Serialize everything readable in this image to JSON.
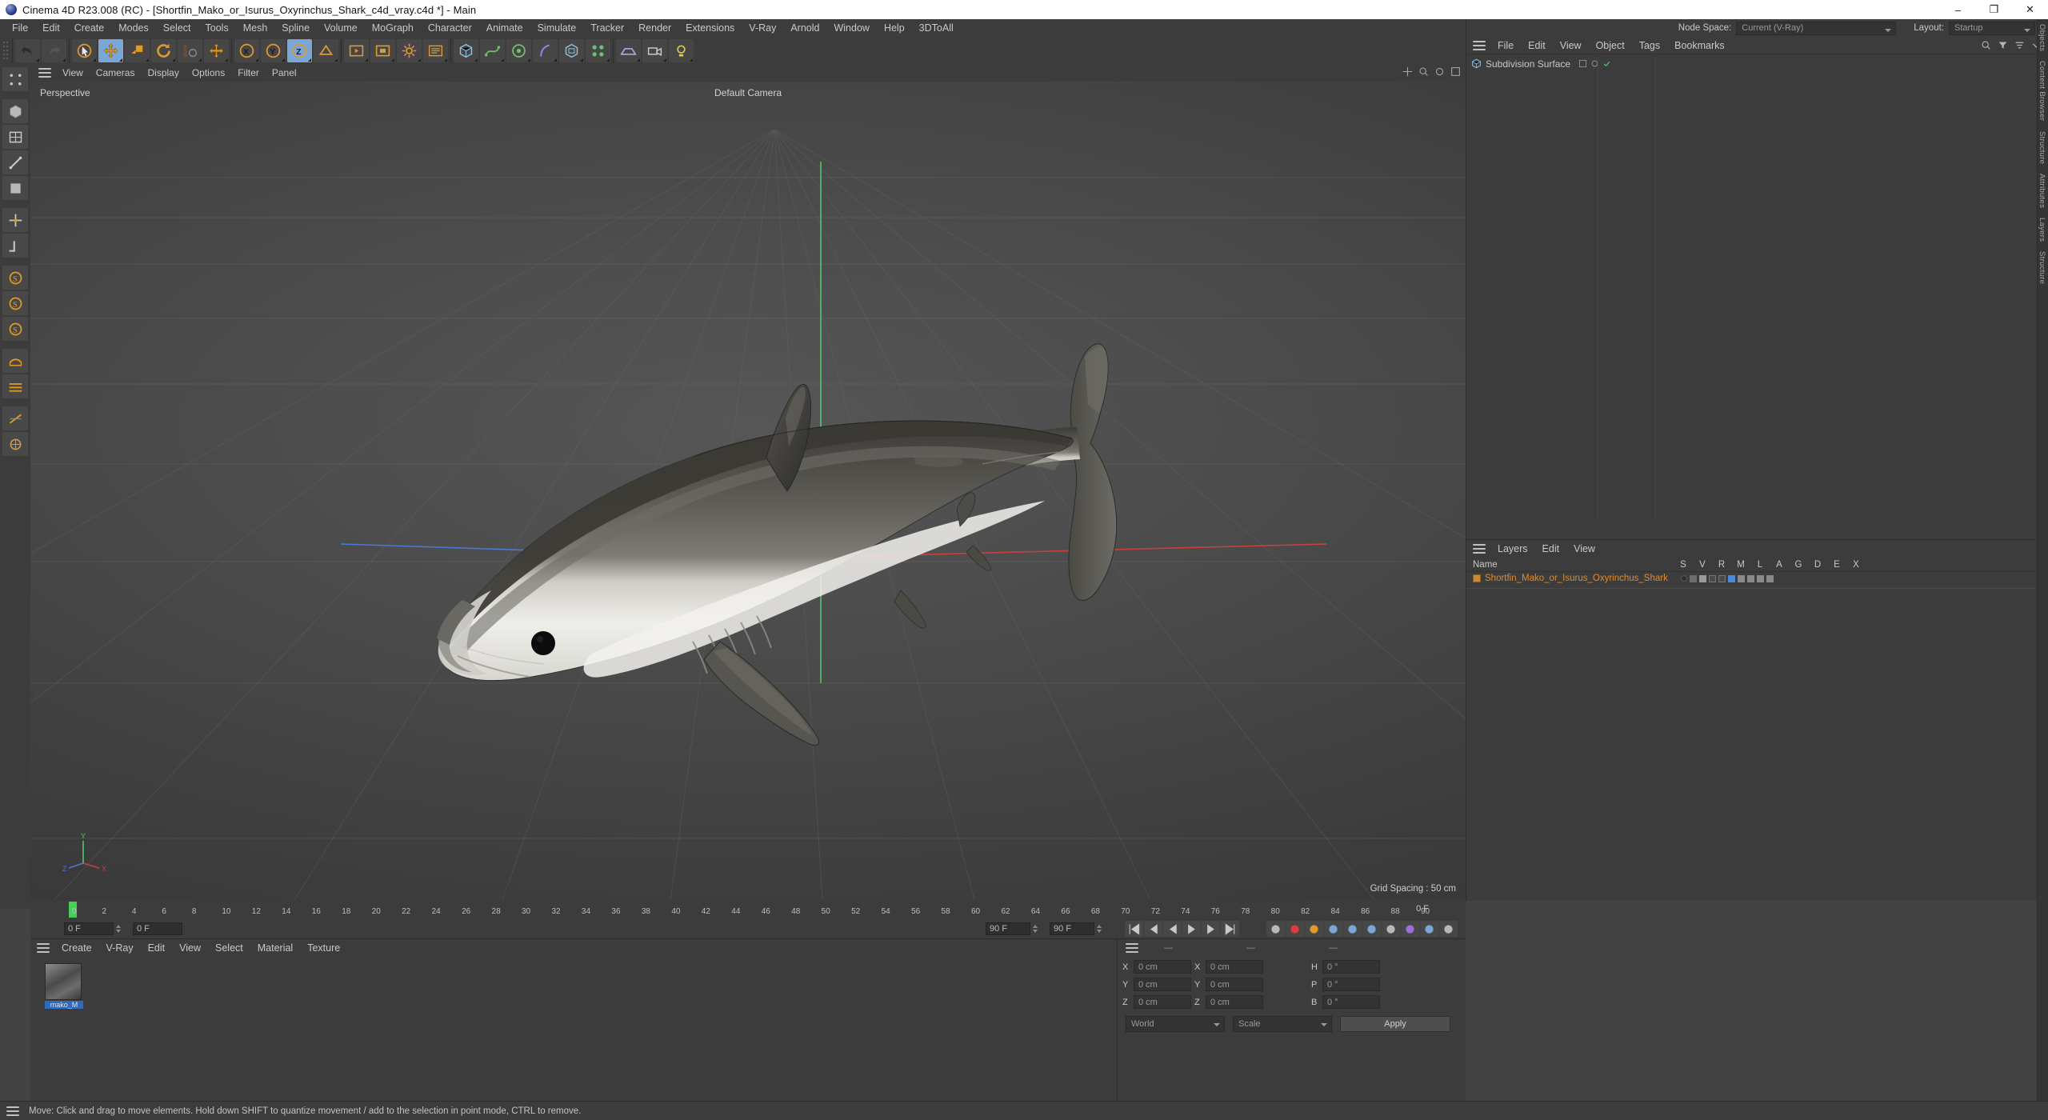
{
  "window": {
    "title": "Cinema 4D R23.008 (RC) - [Shortfin_Mako_or_Isurus_Oxyrinchus_Shark_c4d_vray.c4d *] - Main",
    "minimize": "–",
    "maximize": "❐",
    "close": "✕"
  },
  "menubar": {
    "items": [
      "File",
      "Edit",
      "Create",
      "Modes",
      "Select",
      "Tools",
      "Mesh",
      "Spline",
      "Volume",
      "MoGraph",
      "Character",
      "Animate",
      "Simulate",
      "Tracker",
      "Render",
      "Extensions",
      "V-Ray",
      "Arnold",
      "Window",
      "Help",
      "3DToAll"
    ]
  },
  "toolbar": {
    "groups": [
      {
        "name": "history",
        "buttons": [
          {
            "id": "undo",
            "icon": "undo-arrow-icon",
            "state": "dark"
          },
          {
            "id": "redo",
            "icon": "redo-arrow-icon",
            "state": "dark"
          }
        ]
      },
      {
        "name": "transform",
        "buttons": [
          {
            "id": "select",
            "icon": "live-selection-icon",
            "state": "dark"
          },
          {
            "id": "move",
            "icon": "move-tool-icon",
            "state": "selected"
          },
          {
            "id": "scale",
            "icon": "scale-tool-icon",
            "state": "dark"
          },
          {
            "id": "rotate",
            "icon": "rotate-tool-icon",
            "state": "dark"
          },
          {
            "id": "psr",
            "icon": "psr-icon",
            "state": "dark"
          },
          {
            "id": "move-axis",
            "icon": "move-axis-icon",
            "state": "dark"
          }
        ]
      },
      {
        "name": "axis-locks",
        "buttons": [
          {
            "id": "lock-x",
            "icon": "x-axis-lock-icon",
            "state": "dark"
          },
          {
            "id": "lock-y",
            "icon": "y-axis-lock-icon",
            "state": "dark"
          },
          {
            "id": "lock-z",
            "icon": "z-axis-lock-icon",
            "state": "selected"
          },
          {
            "id": "world-object",
            "icon": "world-coordinate-icon",
            "state": "dark"
          }
        ]
      },
      {
        "name": "render",
        "buttons": [
          {
            "id": "render-view",
            "icon": "render-view-icon",
            "state": "dark"
          },
          {
            "id": "render-region",
            "icon": "render-region-icon",
            "state": "dark"
          },
          {
            "id": "render-settings",
            "icon": "render-settings-icon",
            "state": "dark"
          },
          {
            "id": "render-queue",
            "icon": "render-queue-icon",
            "state": "dark"
          }
        ]
      },
      {
        "name": "primitives",
        "buttons": [
          {
            "id": "cube",
            "icon": "cube-primitive-icon",
            "state": "dark"
          },
          {
            "id": "spline-pen",
            "icon": "spline-pen-icon",
            "state": "dark"
          },
          {
            "id": "array",
            "icon": "array-generator-icon",
            "state": "dark"
          },
          {
            "id": "bend",
            "icon": "bend-deformer-icon",
            "state": "dark"
          },
          {
            "id": "subdivision",
            "icon": "subdivision-surface-icon",
            "state": "dark"
          },
          {
            "id": "mograph",
            "icon": "mograph-cloner-icon",
            "state": "dark"
          }
        ]
      },
      {
        "name": "scene",
        "buttons": [
          {
            "id": "floor",
            "icon": "floor-object-icon",
            "state": "dark"
          },
          {
            "id": "camera",
            "icon": "camera-object-icon",
            "state": "dark"
          },
          {
            "id": "light",
            "icon": "light-object-icon",
            "state": "dark"
          }
        ]
      }
    ]
  },
  "left_palette": {
    "buttons": [
      {
        "id": "point-mode",
        "icon": "point-mode-icon"
      },
      {
        "id": "model-mode",
        "icon": "model-mode-icon"
      },
      {
        "id": "texture-mode",
        "icon": "texture-mode-icon"
      },
      {
        "id": "edge-mode",
        "icon": "edge-mode-icon"
      },
      {
        "id": "polygon-mode",
        "icon": "polygon-mode-icon"
      },
      {
        "id": "enable-axis",
        "icon": "enable-axis-icon"
      },
      {
        "id": "workplane",
        "icon": "workplane-icon"
      },
      {
        "id": "snap-settings",
        "icon": "snap-magnet-icon"
      },
      {
        "id": "snap-quantize",
        "icon": "quantize-snap-icon"
      },
      {
        "id": "snap-workplane",
        "icon": "workplane-snap-icon"
      },
      {
        "id": "viewport-solo",
        "icon": "viewport-solo-icon"
      },
      {
        "id": "layout-grid",
        "icon": "layout-grid-icon"
      },
      {
        "id": "deformer-cage",
        "icon": "deformer-cage-icon"
      },
      {
        "id": "uv-mesh",
        "icon": "uv-mesh-icon"
      }
    ]
  },
  "viewport": {
    "menu": [
      "View",
      "Cameras",
      "Display",
      "Options",
      "Filter",
      "Panel"
    ],
    "label_perspective": "Perspective",
    "label_camera": "Default Camera",
    "grid_spacing": "Grid Spacing : 50 cm",
    "axis_labels": {
      "x": "X",
      "y": "Y",
      "z": "Z"
    },
    "gizmo_colors": {
      "x": "#d24a4a",
      "y": "#4fc96a",
      "z": "#4a78d2"
    }
  },
  "object_manager": {
    "menu": [
      "File",
      "Edit",
      "View",
      "Object",
      "Tags",
      "Bookmarks"
    ],
    "node_space_label": "Node Space:",
    "node_space_value": "Current (V-Ray)",
    "layout_label": "Layout:",
    "layout_value": "Startup",
    "items": [
      {
        "name": "Subdivision Surface",
        "icon": "subdivision-surface-icon",
        "color": "#d8d8d8"
      }
    ]
  },
  "layer_manager": {
    "menu": [
      "Layers",
      "Edit",
      "View"
    ],
    "column_name": "Name",
    "flag_columns": [
      "S",
      "V",
      "R",
      "M",
      "L",
      "A",
      "G",
      "D",
      "E",
      "X"
    ],
    "rows": [
      {
        "name": "Shortfin_Mako_or_Isurus_Oxyrinchus_Shark",
        "color": "#e08b2c"
      }
    ]
  },
  "right_tabs": [
    "Objects",
    "Content Browser",
    "Structure",
    "Attributes",
    "Layers",
    "Structure"
  ],
  "timeline": {
    "ticks": [
      "0",
      "2",
      "4",
      "6",
      "8",
      "10",
      "12",
      "14",
      "16",
      "18",
      "20",
      "22",
      "24",
      "26",
      "28",
      "30",
      "32",
      "34",
      "36",
      "38",
      "40",
      "42",
      "44",
      "46",
      "48",
      "50",
      "52",
      "54",
      "56",
      "58",
      "60",
      "62",
      "64",
      "66",
      "68",
      "70",
      "72",
      "74",
      "76",
      "78",
      "80",
      "82",
      "84",
      "86",
      "88",
      "90"
    ],
    "current_frame": "0 F",
    "end_marker": "0 F"
  },
  "timeline_bar": {
    "frame_start": "0 F",
    "frame_current": "0 F",
    "frame_end": "90 F",
    "frame_preview_end": "90 F",
    "transport": [
      {
        "id": "goto-start",
        "icon": "skip-start-icon"
      },
      {
        "id": "step-back",
        "icon": "step-back-icon"
      },
      {
        "id": "play-back",
        "icon": "play-reverse-icon"
      },
      {
        "id": "play",
        "icon": "play-icon"
      },
      {
        "id": "step-forward",
        "icon": "step-forward-icon"
      },
      {
        "id": "goto-end",
        "icon": "skip-end-icon"
      }
    ],
    "record_tools": [
      {
        "id": "record-active",
        "icon": "record-active-objects-icon",
        "color": "#b8b8b8"
      },
      {
        "id": "autokey",
        "icon": "autokey-icon",
        "color": "#e03a3a"
      },
      {
        "id": "keyframe-select",
        "icon": "keyframe-selection-icon",
        "color": "#e09a2c"
      },
      {
        "id": "position-key",
        "icon": "position-key-icon",
        "color": "#7aa7d8"
      },
      {
        "id": "rotation-key",
        "icon": "rotation-key-icon",
        "color": "#7aa7d8"
      },
      {
        "id": "scale-key",
        "icon": "scale-key-icon",
        "color": "#7aa7d8"
      },
      {
        "id": "param-key",
        "icon": "parameter-key-icon",
        "color": "#b8b8b8"
      },
      {
        "id": "pla-key",
        "icon": "point-level-animation-icon",
        "color": "#9a6fd8"
      },
      {
        "id": "keyframe-mode",
        "icon": "keyframe-mode-icon",
        "color": "#7aa7d8"
      },
      {
        "id": "anim-layer",
        "icon": "animation-layer-icon",
        "color": "#b8b8b8"
      }
    ]
  },
  "material_manager": {
    "menu": [
      "Create",
      "V-Ray",
      "Edit",
      "View",
      "Select",
      "Material",
      "Texture"
    ],
    "materials": [
      {
        "name": "mako_M",
        "selected": true
      }
    ]
  },
  "coordinates": {
    "headers": [
      "—",
      "—",
      "—"
    ],
    "position": [
      {
        "label": "X",
        "value": "0 cm"
      },
      {
        "label": "Y",
        "value": "0 cm"
      },
      {
        "label": "Z",
        "value": "0 cm"
      }
    ],
    "size": [
      {
        "label": "X",
        "value": "0 cm"
      },
      {
        "label": "Y",
        "value": "0 cm"
      },
      {
        "label": "Z",
        "value": "0 cm"
      }
    ],
    "rotation": [
      {
        "label": "H",
        "value": "0 °"
      },
      {
        "label": "P",
        "value": "0 °"
      },
      {
        "label": "B",
        "value": "0 °"
      }
    ],
    "system_value": "World",
    "mode_value": "Scale",
    "apply_label": "Apply"
  },
  "status_bar": {
    "text": "Move: Click and drag to move elements. Hold down SHIFT to quantize movement / add to the selection in point mode, CTRL to remove."
  }
}
